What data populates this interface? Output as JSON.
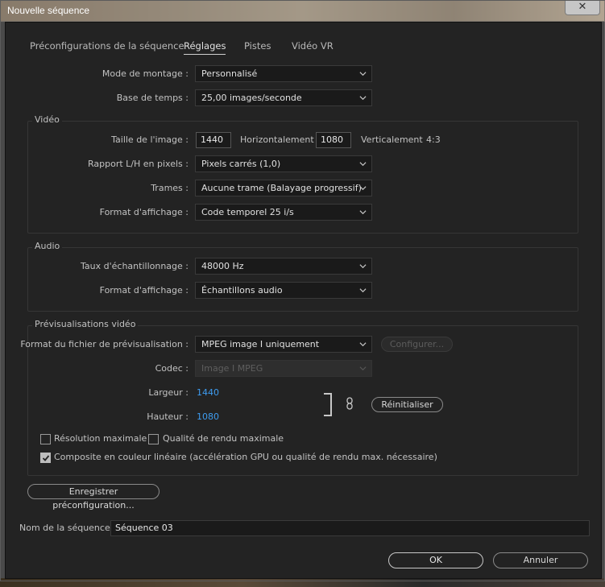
{
  "window": {
    "title": "Nouvelle séquence",
    "close_icon": "close-icon"
  },
  "tabs": [
    {
      "label": "Préconfigurations de la séquence",
      "active": false
    },
    {
      "label": "Réglages",
      "active": true
    },
    {
      "label": "Pistes",
      "active": false
    },
    {
      "label": "Vidéo VR",
      "active": false
    }
  ],
  "settings": {
    "editing_mode_label": "Mode de montage :",
    "editing_mode_value": "Personnalisé",
    "timebase_label": "Base de temps :",
    "timebase_value": "25,00  images/seconde"
  },
  "video": {
    "group_title": "Vidéo",
    "frame_size_label": "Taille de l'image :",
    "width_value": "1440",
    "horizontal_label": "Horizontalement",
    "height_value": "1080",
    "vertical_label": "Verticalement",
    "aspect_ratio": "4:3",
    "pixel_aspect_label": "Rapport L/H en pixels :",
    "pixel_aspect_value": "Pixels carrés (1,0)",
    "fields_label": "Trames :",
    "fields_value": "Aucune trame (Balayage progressif)",
    "display_format_label": "Format d'affichage :",
    "display_format_value": "Code temporel 25 i/s"
  },
  "audio": {
    "group_title": "Audio",
    "sample_rate_label": "Taux d'échantillonnage :",
    "sample_rate_value": "48000 Hz",
    "display_format_label": "Format d'affichage :",
    "display_format_value": "Échantillons audio"
  },
  "preview": {
    "group_title": "Prévisualisations vidéo",
    "file_format_label": "Format du fichier de prévisualisation :",
    "file_format_value": "MPEG image I uniquement",
    "configure_label": "Configurer...",
    "codec_label": "Codec :",
    "codec_value": "Image I MPEG",
    "width_label": "Largeur :",
    "width_value": "1440",
    "height_label": "Hauteur :",
    "height_value": "1080",
    "reset_label": "Réinitialiser",
    "max_resolution_label": "Résolution maximale",
    "max_resolution_checked": false,
    "max_quality_label": "Qualité de rendu maximale",
    "max_quality_checked": false,
    "linear_composite_label": "Composite en couleur linéaire (accélération GPU ou qualité de rendu max. nécessaire)",
    "linear_composite_checked": true
  },
  "save_preset_label": "Enregistrer préconfiguration...",
  "sequence_name_label": "Nom de la séquence :",
  "sequence_name_value": "Séquence 03",
  "ok_label": "OK",
  "cancel_label": "Annuler",
  "colors": {
    "accent_blue": "#3e9cf0",
    "dialog_bg": "#232323"
  }
}
